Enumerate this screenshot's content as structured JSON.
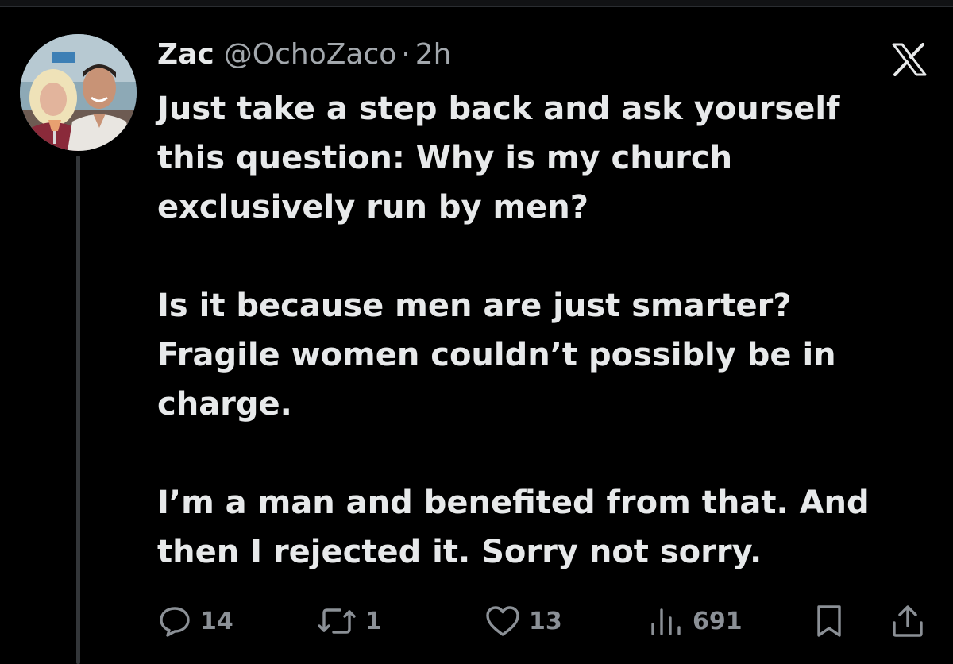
{
  "tweet": {
    "author": {
      "display_name": "Zac",
      "handle": "@OchoZaco",
      "avatar_icon": "avatar-photo"
    },
    "separator": "·",
    "timestamp": "2h",
    "platform_icon": "x-logo-icon",
    "paragraphs": [
      "Just take a step back and ask yourself\nthis question: Why is my church\nexclusively run by men?",
      "Is it because men are just smarter?\nFragile women couldn’t possibly be in\ncharge.",
      "I’m a man and benefited from that. And\nthen I rejected it. Sorry not sorry."
    ],
    "actions": {
      "reply": {
        "icon": "reply-icon",
        "count": "14"
      },
      "repost": {
        "icon": "repost-icon",
        "count": "1"
      },
      "like": {
        "icon": "heart-icon",
        "count": "13"
      },
      "views": {
        "icon": "views-icon",
        "count": "691"
      },
      "bookmark": {
        "icon": "bookmark-icon"
      },
      "share": {
        "icon": "share-icon"
      }
    }
  },
  "colors": {
    "background": "#000000",
    "text_primary": "#e7e9ea",
    "text_secondary": "#8b9096",
    "thread_line": "#333639"
  }
}
